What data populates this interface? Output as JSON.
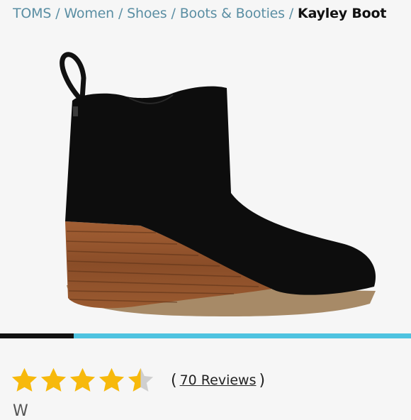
{
  "breadcrumb": {
    "items": [
      "TOMS",
      "Women",
      "Shoes",
      "Boots & Booties"
    ],
    "separator": "/",
    "current": "Kayley Boot"
  },
  "product": {
    "image_icon": "black-suede-wedge-ankle-boot"
  },
  "carousel": {
    "progress_fraction": 0.18
  },
  "rating": {
    "value": 4.5,
    "max": 5,
    "reviews_count": "70",
    "reviews_label": "70 Reviews"
  },
  "colors": {
    "link": "#5a8ea3",
    "star": "#f7b90c",
    "star_empty": "#cfcfcf",
    "carousel_accent": "#4fc3e0",
    "carousel_dark": "#121212"
  }
}
